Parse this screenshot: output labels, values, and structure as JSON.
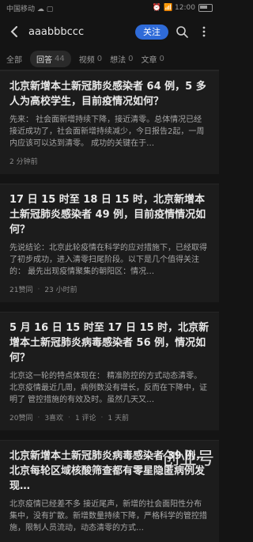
{
  "status": {
    "left": "中国移动 ☁ ▢",
    "right": "⏰ 📶 12:00"
  },
  "topbar": {
    "username": "aaabbbccc",
    "follow_label": "关注"
  },
  "tabs": [
    {
      "label": "全部",
      "count": ""
    },
    {
      "label": "回答",
      "count": "44"
    },
    {
      "label": "视频",
      "count": "0"
    },
    {
      "label": "想法",
      "count": "0"
    },
    {
      "label": "文章",
      "count": "0"
    }
  ],
  "cards": [
    {
      "title": "北京新增本土新冠肺炎感染者 64 例，5 多人为高校学生，目前疫情况如何？",
      "excerpt": "先来： 社会面新增持续下降，接近清零。总体情况已经接近成功了，社会面新增持续减少，今日报告2起，一周内应该可以达到清零。 成功的关键在于…",
      "meta": [
        "2 分钟前"
      ]
    },
    {
      "title": "17 日 15 时至 18 日 15 时，北京新增本土新冠肺炎感染者 49 例，目前疫情情况如何？",
      "excerpt": "先说结论：北京此轮疫情在科学的应对措施下，已经取得了初步成功，进入清零扫尾阶段。以下是几个值得关注的： 最先出现疫情聚集的朝阳区：情况…",
      "meta": [
        "21赞同",
        "23 小时前"
      ]
    },
    {
      "title": "5 月 16 日 15 时至 17 日 15 时，北京新增本土新冠肺炎病毒感染者 56 例，情况如何？",
      "excerpt": "北京这一轮的特点体现在： 精准防控的方式动态清零。北京疫情最近几周，病例数没有增长，反而在下降中，证明了 管控措施的有效及时。虽然几天又…",
      "meta": [
        "20赞同",
        "3喜欢",
        "1 评论",
        "1 天前"
      ]
    },
    {
      "title": "北京新增本土新冠肺炎病毒感染者 39 例，北京每轮区域核酸筛查都有零星隐匿病例发现…",
      "excerpt": "北京疫情已经差不多 接近尾声，新增的社会面阳性分布集中，没有扩散。新增数量持续下降，严格科学的管控措施，限制人员流动，动态清零的方式…",
      "meta": []
    }
  ],
  "watermark": "创业号"
}
